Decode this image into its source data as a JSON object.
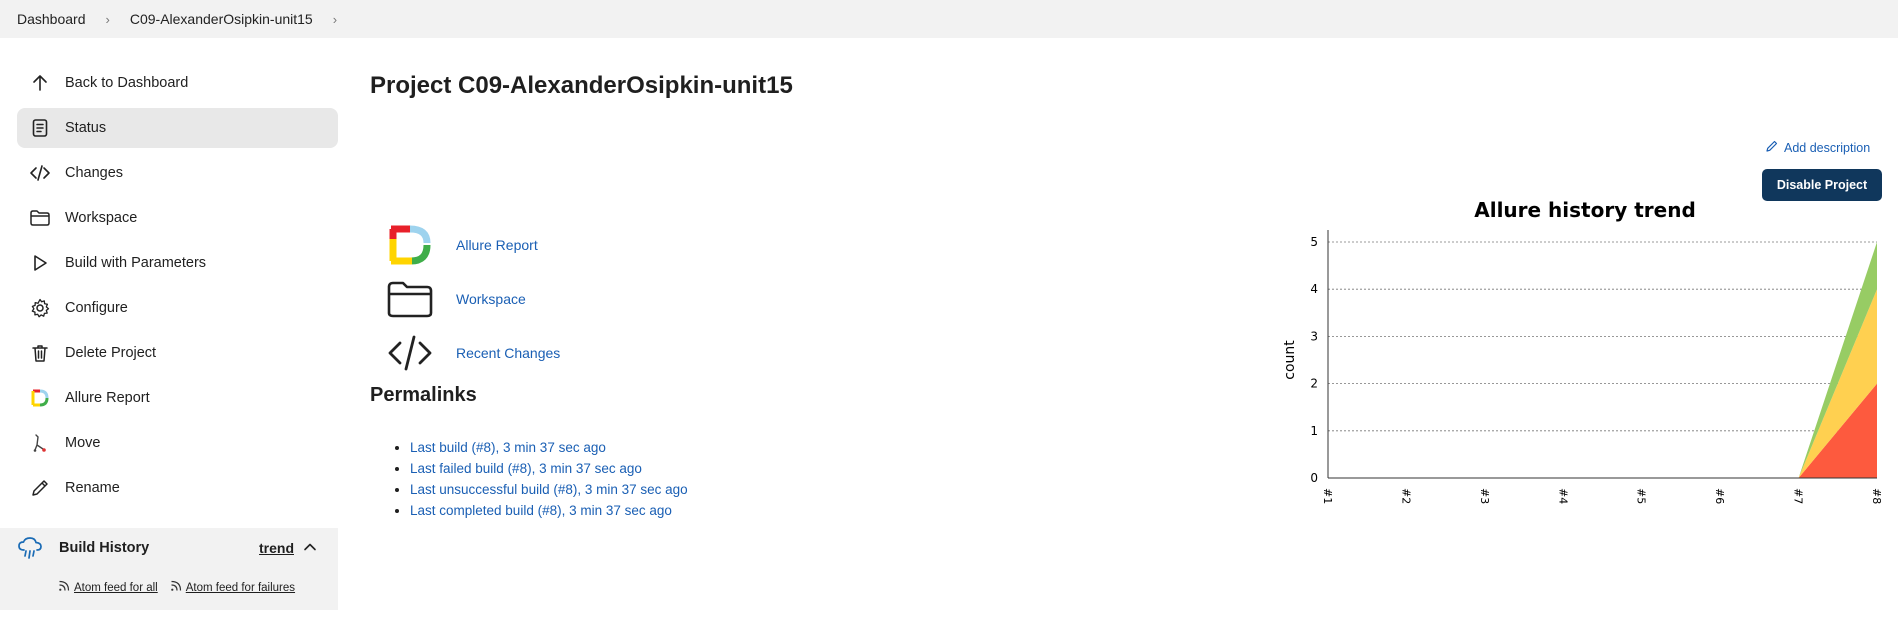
{
  "breadcrumb": {
    "items": [
      "Dashboard",
      "C09-AlexanderOsipkin-unit15"
    ]
  },
  "sidebar": {
    "items": [
      {
        "label": "Back to Dashboard",
        "icon": "arrow-up-icon"
      },
      {
        "label": "Status",
        "icon": "status-document-icon",
        "active": true
      },
      {
        "label": "Changes",
        "icon": "code-icon"
      },
      {
        "label": "Workspace",
        "icon": "folder-icon"
      },
      {
        "label": "Build with Parameters",
        "icon": "play-icon"
      },
      {
        "label": "Configure",
        "icon": "gear-icon"
      },
      {
        "label": "Delete Project",
        "icon": "trash-icon"
      },
      {
        "label": "Allure Report",
        "icon": "allure-logo-icon"
      },
      {
        "label": "Move",
        "icon": "move-icon"
      },
      {
        "label": "Rename",
        "icon": "pencil-icon"
      }
    ]
  },
  "build_history": {
    "title": "Build History",
    "trend": "trend",
    "feed_all": "Atom feed for all",
    "feed_failures": "Atom feed for failures"
  },
  "main": {
    "title": "Project C09-AlexanderOsipkin-unit15",
    "add_description": "Add description",
    "disable_button": "Disable Project",
    "links": [
      {
        "label": "Allure Report",
        "icon": "allure-logo-icon"
      },
      {
        "label": "Workspace",
        "icon": "folder-icon"
      },
      {
        "label": "Recent Changes",
        "icon": "code-icon"
      }
    ],
    "permalinks_title": "Permalinks",
    "permalinks": [
      "Last build (#8), 3 min 37 sec ago",
      "Last failed build (#8), 3 min 37 sec ago",
      "Last unsuccessful build (#8), 3 min 37 sec ago",
      "Last completed build (#8), 3 min 37 sec ago"
    ]
  },
  "colors": {
    "accent_button": "#10375c",
    "link": "#1a5fb4",
    "failed": "#fd5a3e",
    "broken": "#ffd050",
    "passed": "#97cc64"
  },
  "chart_data": {
    "type": "area",
    "title": "Allure history trend",
    "xlabel": "",
    "ylabel": "count",
    "x": [
      "#1",
      "#2",
      "#3",
      "#4",
      "#5",
      "#6",
      "#7",
      "#8"
    ],
    "ylim": [
      0,
      5
    ],
    "yticks": [
      0,
      1,
      2,
      3,
      4,
      5
    ],
    "grid": true,
    "stacked": true,
    "series": [
      {
        "color": "#fd5a3e",
        "values": [
          0,
          0,
          0,
          0,
          0,
          0,
          0,
          2
        ]
      },
      {
        "color": "#ffd050",
        "values": [
          0,
          0,
          0,
          0,
          0,
          0,
          0,
          2
        ]
      },
      {
        "color": "#97cc64",
        "values": [
          0,
          0,
          0,
          0,
          0,
          0,
          0,
          1
        ]
      }
    ]
  }
}
